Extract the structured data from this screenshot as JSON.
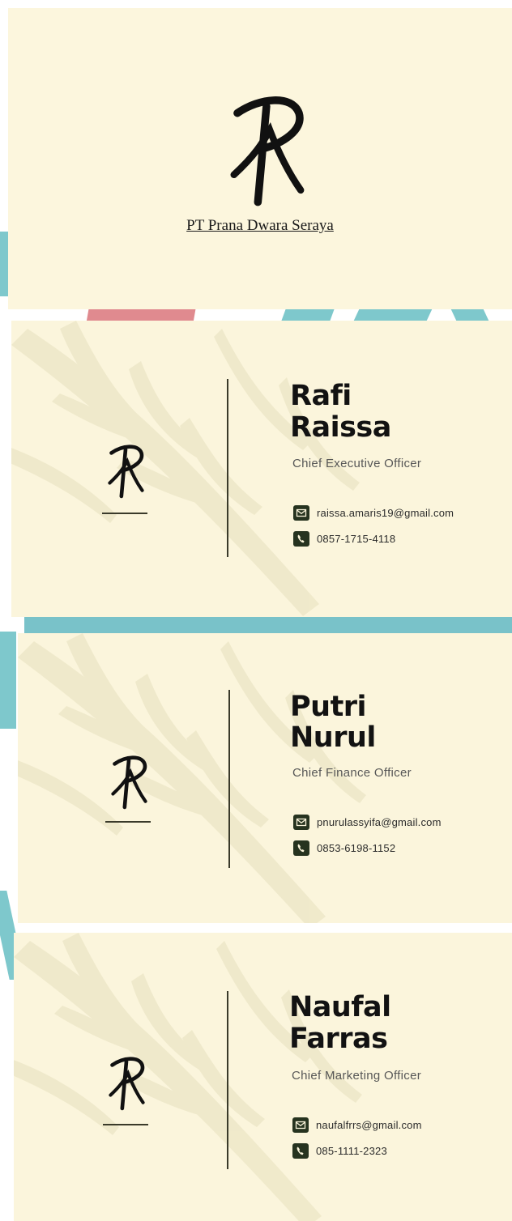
{
  "company": {
    "name": "PT Prana Dwara Seraya"
  },
  "cards": [
    {
      "first_name": "Rafi",
      "last_name": "Raissa",
      "role": "Chief Executive Officer",
      "email": "raissa.amaris19@gmail.com",
      "phone": "0857-1715-4118"
    },
    {
      "first_name": "Putri",
      "last_name": "Nurul",
      "role": "Chief Finance Officer",
      "email": "pnurulassyifa@gmail.com",
      "phone": "0853-6198-1152"
    },
    {
      "first_name": "Naufal",
      "last_name": "Farras",
      "role": "Chief Marketing Officer",
      "email": "naufalfrrs@gmail.com",
      "phone": "085-1111-2323"
    }
  ],
  "icons": {
    "logo": "monogram-logo-icon",
    "email": "mail-icon",
    "phone": "phone-icon"
  },
  "colors": {
    "card_background": "#fbf5dc",
    "text_dark": "#121212",
    "icon_fill": "#26331f",
    "accent_teal": "#7ec8cc",
    "accent_pink": "#e08a8f"
  }
}
